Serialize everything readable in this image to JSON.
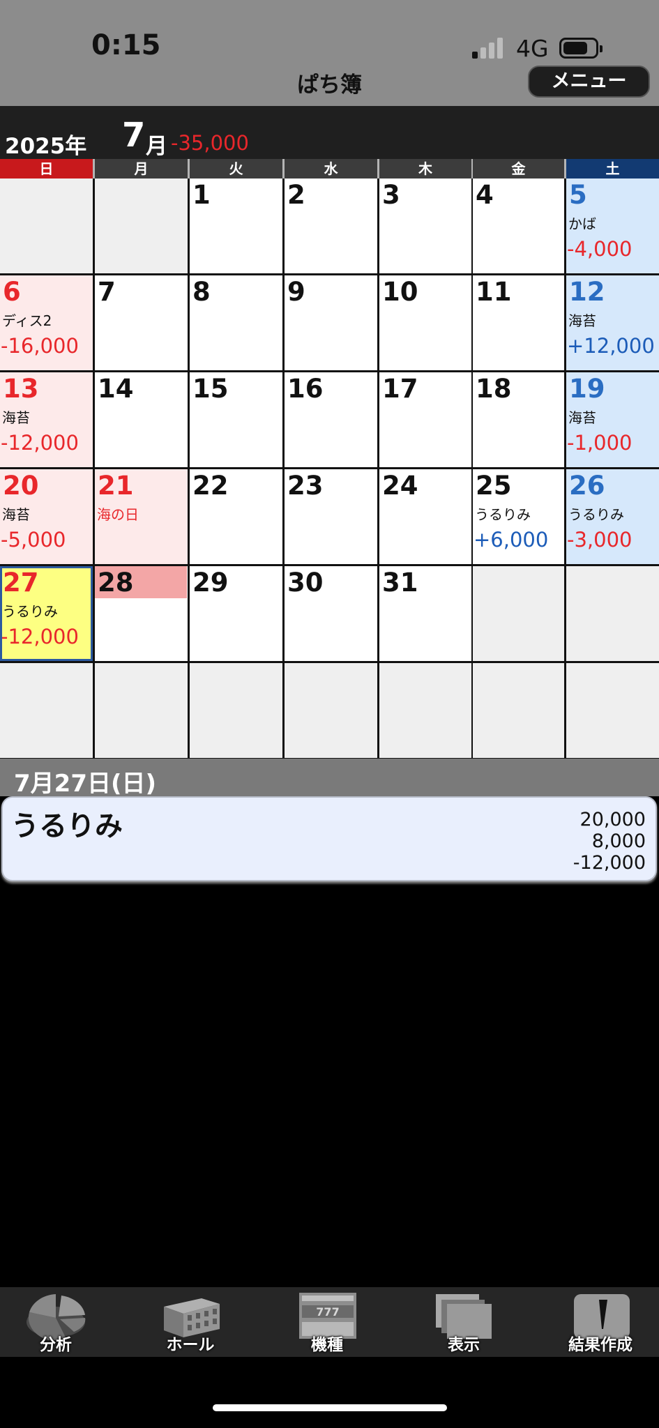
{
  "status": {
    "time": "0:15",
    "network": "4G"
  },
  "app": {
    "title": "ぱち簿",
    "menu_label": "メニュー"
  },
  "month_header": {
    "year": "2025年",
    "month": "7",
    "month_unit": "月",
    "total": "-35,000"
  },
  "weekdays": [
    "日",
    "月",
    "火",
    "水",
    "木",
    "金",
    "土"
  ],
  "calendar": {
    "weeks": [
      [
        {
          "day": "",
          "type": "empty"
        },
        {
          "day": "",
          "type": "empty"
        },
        {
          "day": "1",
          "type": "normal"
        },
        {
          "day": "2",
          "type": "normal"
        },
        {
          "day": "3",
          "type": "normal"
        },
        {
          "day": "4",
          "type": "normal"
        },
        {
          "day": "5",
          "type": "sat",
          "place": "かば",
          "amount": "-4,000"
        }
      ],
      [
        {
          "day": "6",
          "type": "sun",
          "place": "ディス2",
          "amount": "-16,000"
        },
        {
          "day": "7",
          "type": "normal"
        },
        {
          "day": "8",
          "type": "normal"
        },
        {
          "day": "9",
          "type": "normal"
        },
        {
          "day": "10",
          "type": "normal"
        },
        {
          "day": "11",
          "type": "normal"
        },
        {
          "day": "12",
          "type": "sat",
          "place": "海苔",
          "amount": "+12,000"
        }
      ],
      [
        {
          "day": "13",
          "type": "sun",
          "place": "海苔",
          "amount": "-12,000"
        },
        {
          "day": "14",
          "type": "normal"
        },
        {
          "day": "15",
          "type": "normal"
        },
        {
          "day": "16",
          "type": "normal"
        },
        {
          "day": "17",
          "type": "normal"
        },
        {
          "day": "18",
          "type": "normal"
        },
        {
          "day": "19",
          "type": "sat",
          "place": "海苔",
          "amount": "-1,000"
        }
      ],
      [
        {
          "day": "20",
          "type": "sun",
          "place": "海苔",
          "amount": "-5,000"
        },
        {
          "day": "21",
          "type": "holiday",
          "place": "海の日"
        },
        {
          "day": "22",
          "type": "normal"
        },
        {
          "day": "23",
          "type": "normal"
        },
        {
          "day": "24",
          "type": "normal"
        },
        {
          "day": "25",
          "type": "normal",
          "place": "うるりみ",
          "amount": "+6,000"
        },
        {
          "day": "26",
          "type": "sat",
          "place": "うるりみ",
          "amount": "-3,000"
        }
      ],
      [
        {
          "day": "27",
          "type": "today",
          "place": "うるりみ",
          "amount": "-12,000"
        },
        {
          "day": "28",
          "type": "highlight"
        },
        {
          "day": "29",
          "type": "normal"
        },
        {
          "day": "30",
          "type": "normal"
        },
        {
          "day": "31",
          "type": "normal"
        },
        {
          "day": "",
          "type": "empty"
        },
        {
          "day": "",
          "type": "empty"
        }
      ],
      [
        {
          "day": "",
          "type": "empty"
        },
        {
          "day": "",
          "type": "empty"
        },
        {
          "day": "",
          "type": "empty"
        },
        {
          "day": "",
          "type": "empty"
        },
        {
          "day": "",
          "type": "empty"
        },
        {
          "day": "",
          "type": "empty"
        },
        {
          "day": "",
          "type": "empty"
        }
      ]
    ]
  },
  "detail": {
    "date": "7月27日(日)",
    "records": [
      {
        "name": "うるりみ",
        "investment": "20,000",
        "recovery": "8,000",
        "balance": "-12,000"
      }
    ]
  },
  "tabs": [
    {
      "label": "分析",
      "icon": "pie-chart-icon"
    },
    {
      "label": "ホール",
      "icon": "building-icon"
    },
    {
      "label": "機種",
      "icon": "slot-machine-icon"
    },
    {
      "label": "表示",
      "icon": "layers-icon"
    },
    {
      "label": "結果作成",
      "icon": "pencil-icon"
    }
  ],
  "colors": {
    "negative": "#e8272b",
    "positive": "#1c5cb8",
    "sunday_header": "#c8191c",
    "saturday_header": "#123a72",
    "today": "#fdff82"
  }
}
